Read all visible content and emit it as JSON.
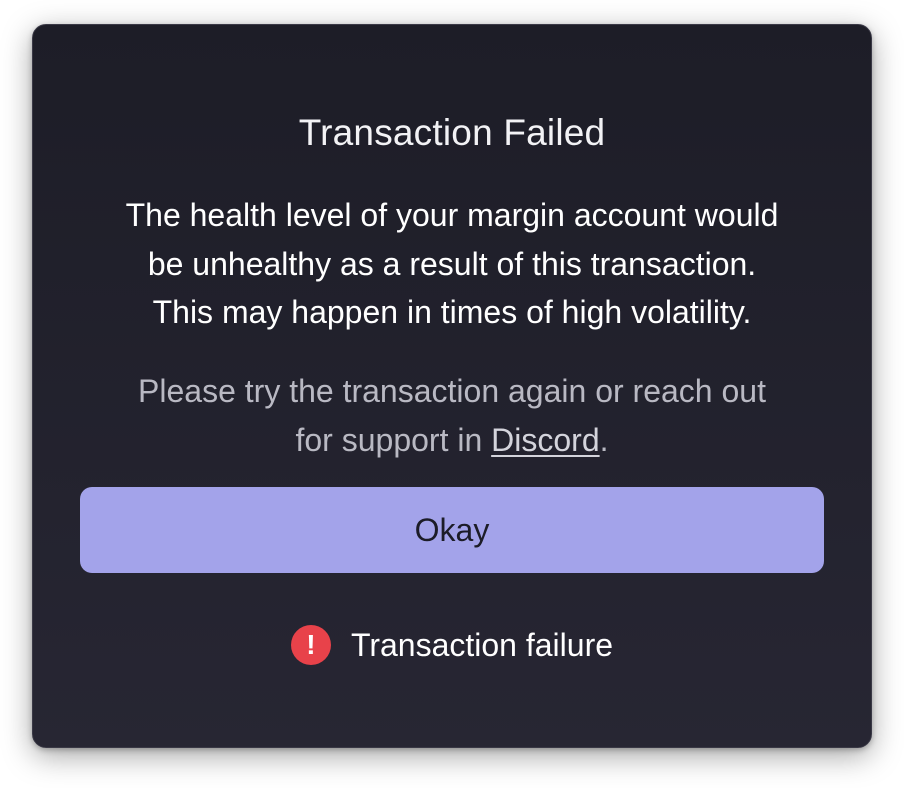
{
  "modal": {
    "title": "Transaction Failed",
    "message_lines": [
      "The health level of your margin account would",
      "be unhealthy as a result of this transaction.",
      "This may happen in times of high volatility."
    ],
    "support": {
      "line1": "Please try the transaction again or reach out",
      "line2_prefix": "for support in ",
      "link_text": "Discord",
      "line2_suffix": "."
    },
    "okay_label": "Okay",
    "status": {
      "icon": "exclamation-circle-icon",
      "icon_glyph": "!",
      "icon_color": "#e8424a",
      "text": "Transaction failure"
    }
  },
  "colors": {
    "background": "#1d1d27",
    "button": "#a3a3ea",
    "error": "#e8424a"
  }
}
